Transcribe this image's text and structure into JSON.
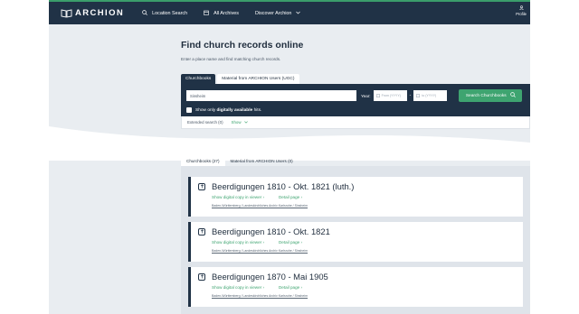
{
  "header": {
    "logo_text": "ARCHION",
    "nav": {
      "location_search": "Location Search",
      "all_archives": "All Archives",
      "discover": "Discover Archion"
    },
    "profile_label": "Profile"
  },
  "hero": {
    "title": "Find church records online",
    "subtitle": "Enter a place name and find matching church records."
  },
  "search": {
    "tabs": [
      "Churchbooks",
      "Material from ARCHION Users (UGC)"
    ],
    "place_value": "Sinsheim",
    "year_label": "Year:",
    "from_placeholder": "From (YYYY)",
    "to_placeholder": "to (YYYY)",
    "button_label": "Search Churchbooks",
    "checkbox_prefix": "Show only",
    "checkbox_bold": "digitally available",
    "checkbox_suffix": "hits.",
    "extended_label": "Extended search (0)",
    "extended_show": "Show"
  },
  "results": {
    "tabs": [
      "Churchbooks (27)",
      "Material from ARCHION Users (0)"
    ],
    "items": [
      {
        "title": "Beerdigungen 1810 - Okt. 1821 (luth.)",
        "view_link": "Show digital copy in viewer",
        "detail_link": "Detail page",
        "path": "Baden-Württemberg / Landeskirchliches Archiv Karlsruhe / Sinsheim"
      },
      {
        "title": "Beerdigungen 1810 - Okt. 1821",
        "view_link": "Show digital copy in viewer",
        "detail_link": "Detail page",
        "path": "Baden-Württemberg / Landeskirchliches Archiv Karlsruhe / Sinsheim"
      },
      {
        "title": "Beerdigungen 1870 - Mai 1905",
        "view_link": "Show digital copy in viewer",
        "detail_link": "Detail page",
        "path": "Baden-Württemberg / Landeskirchliches Archiv Karlsruhe / Sinsheim"
      }
    ]
  },
  "colors": {
    "navy": "#203246",
    "green": "#3ea470",
    "background": "#e9edf1"
  }
}
